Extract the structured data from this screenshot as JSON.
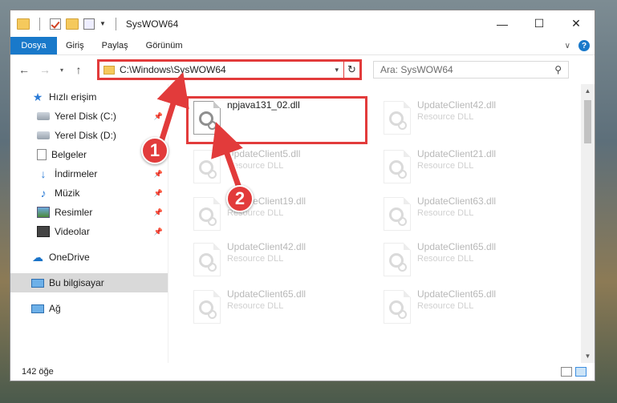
{
  "window": {
    "title": "SysWOW64",
    "controls": [
      "—",
      "☐",
      "✕"
    ]
  },
  "ribbon": {
    "tabs": [
      "Dosya",
      "Giriş",
      "Paylaş",
      "Görünüm"
    ],
    "help": "?"
  },
  "nav": {
    "back": "←",
    "forward": "→",
    "recent": "▾",
    "up": "↑",
    "address": "C:\\Windows\\SysWOW64",
    "address_dropdown": "▾",
    "refresh": "↻",
    "search_placeholder": "Ara: SysWOW64"
  },
  "sidebar": {
    "quick_access": "Hızlı erişim",
    "items": [
      {
        "label": "Yerel Disk (C:)",
        "icon": "drive-icon",
        "pinned": true
      },
      {
        "label": "Yerel Disk (D:)",
        "icon": "drive-icon",
        "pinned": false
      },
      {
        "label": "Belgeler",
        "icon": "documents-icon",
        "pinned": true
      },
      {
        "label": "İndirmeler",
        "icon": "downloads-icon",
        "pinned": true
      },
      {
        "label": "Müzik",
        "icon": "music-icon",
        "pinned": true
      },
      {
        "label": "Resimler",
        "icon": "pictures-icon",
        "pinned": true
      },
      {
        "label": "Videolar",
        "icon": "videos-icon",
        "pinned": true
      }
    ],
    "onedrive": "OneDrive",
    "this_pc": "Bu bilgisayar",
    "network": "Ağ"
  },
  "files": [
    {
      "name": "npjava131_02.dll",
      "desc": "",
      "highlighted": true
    },
    {
      "name": "UpdateClient42.dll",
      "desc": "Resource DLL"
    },
    {
      "name": "UpdateClient5.dll",
      "desc": "Resource DLL"
    },
    {
      "name": "UpdateClient21.dll",
      "desc": "Resource DLL"
    },
    {
      "name": "UpdateClient19.dll",
      "desc": "Resource DLL"
    },
    {
      "name": "UpdateClient63.dll",
      "desc": "Resource DLL"
    },
    {
      "name": "UpdateClient42.dll",
      "desc": "Resource DLL"
    },
    {
      "name": "UpdateClient65.dll",
      "desc": "Resource DLL"
    },
    {
      "name": "UpdateClient65.dll",
      "desc": "Resource DLL"
    },
    {
      "name": "UpdateClient65.dll",
      "desc": "Resource DLL"
    }
  ],
  "status": {
    "count": "142 öğe"
  },
  "annotations": {
    "step1": "1",
    "step2": "2",
    "color": "#e23b3b"
  }
}
